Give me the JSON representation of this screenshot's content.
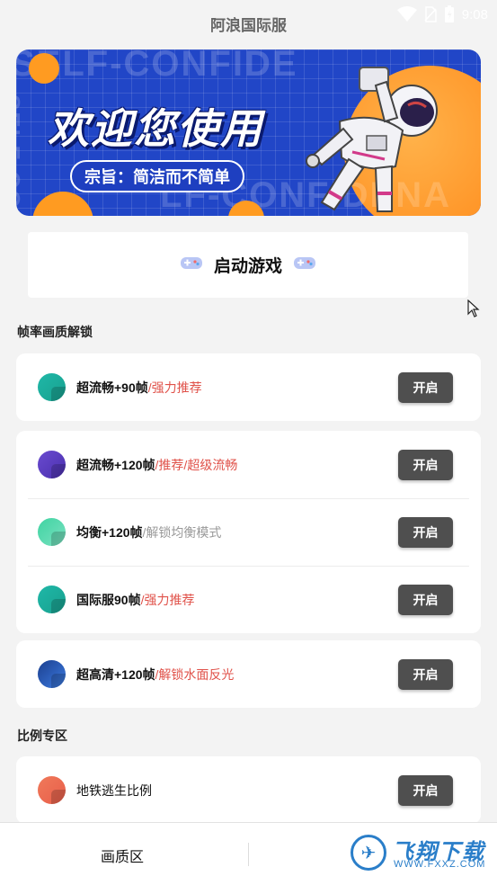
{
  "status_bar": {
    "app_title": "阿浪国际服",
    "time": "9:08"
  },
  "banner": {
    "title": "欢迎您使用",
    "slogan": "宗旨：简洁而不简单",
    "bg_text_1": "SELF-CONFIDE",
    "bg_text_2": "LF-CONFIDENA",
    "bg_text_3": "SELF-CONF"
  },
  "launch": {
    "label": "启动游戏"
  },
  "sections": [
    {
      "title": "帧率画质解锁"
    },
    {
      "title": "比例专区"
    }
  ],
  "groups": [
    {
      "items": [
        {
          "name": "超流畅+90帧",
          "tag": "/强力推荐",
          "tag_color": "red",
          "icon_colors": [
            "#1fb8a8",
            "#18a08e"
          ],
          "button": "开启"
        }
      ]
    },
    {
      "items": [
        {
          "name": "超流畅+120帧",
          "tag": "/推荐/超级流畅",
          "tag_color": "red",
          "icon_colors": [
            "#6a4bd0",
            "#4a2fae"
          ],
          "button": "开启"
        },
        {
          "name": "均衡+120帧",
          "tag": "/解锁均衡模式",
          "tag_color": "gray",
          "icon_colors": [
            "#3fd4a2",
            "#7be0c0"
          ],
          "button": "开启"
        },
        {
          "name": "国际服90帧",
          "tag": "/强力推荐",
          "tag_color": "red",
          "icon_colors": [
            "#1fb8a8",
            "#18a08e"
          ],
          "button": "开启"
        }
      ]
    },
    {
      "items": [
        {
          "name": "超高清+120帧",
          "tag": "/解锁水面反光",
          "tag_color": "red",
          "icon_colors": [
            "#1b3f8f",
            "#3d7be0"
          ],
          "button": "开启"
        }
      ]
    },
    {
      "items": [
        {
          "name": "地铁逃生比例",
          "tag": "",
          "tag_color": "red",
          "icon_colors": [
            "#f07a5a",
            "#e85d4a"
          ],
          "button": "开启"
        }
      ]
    }
  ],
  "bottom_nav": {
    "left_label": "画质区"
  },
  "watermark": {
    "text": "飞翔下载",
    "url": "WWW.FXXZ.COM"
  },
  "colors": {
    "accent_red": "#e0524a",
    "button_bg": "#4f4f4f",
    "banner_blue": "#2146c7",
    "banner_orange": "#ff9b21"
  }
}
